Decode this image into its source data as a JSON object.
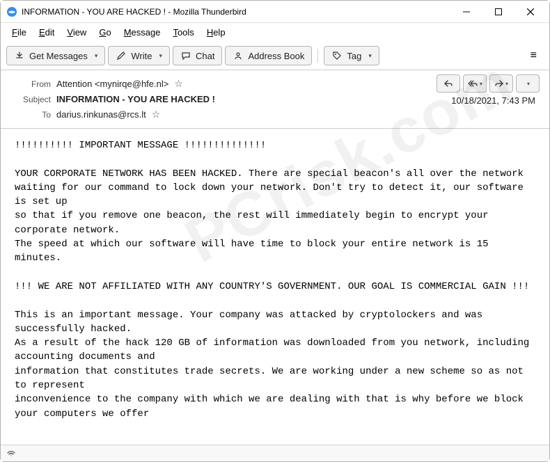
{
  "window": {
    "title": "INFORMATION - YOU ARE HACKED ! - Mozilla Thunderbird"
  },
  "menubar": {
    "file": "File",
    "edit": "Edit",
    "view": "View",
    "go": "Go",
    "message": "Message",
    "tools": "Tools",
    "help": "Help"
  },
  "toolbar": {
    "get_messages": "Get Messages",
    "write": "Write",
    "chat": "Chat",
    "address_book": "Address Book",
    "tag": "Tag"
  },
  "headers": {
    "from_label": "From",
    "from_value": "Attention <mynirqe@hfe.nl>",
    "subject_label": "Subject",
    "subject_value": "INFORMATION - YOU ARE HACKED !",
    "to_label": "To",
    "to_value": "darius.rinkunas@rcs.lt",
    "date": "10/18/2021, 7:43 PM"
  },
  "body": "!!!!!!!!!! IMPORTANT MESSAGE !!!!!!!!!!!!!!\n\nYOUR CORPORATE NETWORK HAS BEEN HACKED. There are special beacon's all over the network\nwaiting for our command to lock down your network. Don't try to detect it, our software is set up\nso that if you remove one beacon, the rest will immediately begin to encrypt your corporate network.\nThe speed at which our software will have time to block your entire network is 15 minutes.\n\n!!! WE ARE NOT AFFILIATED WITH ANY COUNTRY'S GOVERNMENT. OUR GOAL IS COMMERCIAL GAIN !!!\n\nThis is an important message. Your company was attacked by cryptolockers and was successfully hacked.\nAs a result of the hack 120 GB of information was downloaded from you network, including accounting documents and\ninformation that constitutes trade secrets. We are working under a new scheme so as not to represent\ninconvenience to the company with which we are dealing with that is why before we block your computers we offer",
  "watermark": "PCrisk.com"
}
